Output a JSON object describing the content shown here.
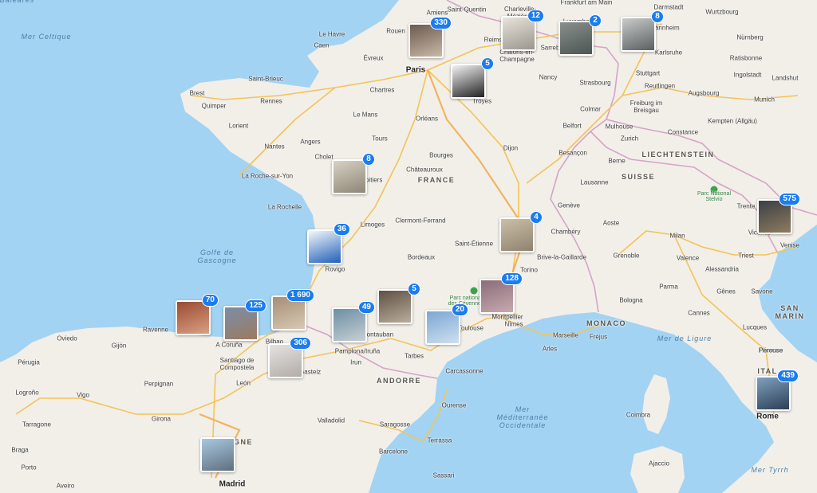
{
  "colors": {
    "water": "#a3d3f3",
    "land": "#f2efe9",
    "border": "#d6a3c8",
    "road": "#f4c356",
    "highway": "#f4a844",
    "badge": "#1a7cf0"
  },
  "labels": [
    {
      "text": "Mer Celtique",
      "cls": "sea"
    },
    {
      "text": "Golfe de\nGascogne",
      "cls": "sea"
    },
    {
      "text": "Mer de Ligure",
      "cls": "sea"
    },
    {
      "text": "Mer\nMéditerranée\nOccidentale",
      "cls": "sea"
    },
    {
      "text": "Mer Tyrrh",
      "cls": "sea"
    },
    {
      "text": "FRANCE",
      "cls": "country"
    },
    {
      "text": "SUISSE",
      "cls": "country"
    },
    {
      "text": "ITAL",
      "cls": "country"
    },
    {
      "text": "GNE",
      "cls": "country"
    },
    {
      "text": "ANDORRE",
      "cls": "country"
    },
    {
      "text": "MONACO",
      "cls": "country"
    },
    {
      "text": "LIECHTENSTEIN",
      "cls": "country"
    },
    {
      "text": "SAN\nMARIN",
      "cls": "country"
    },
    {
      "text": "Paris",
      "cls": "capital"
    },
    {
      "text": "Madrid",
      "cls": "capital"
    },
    {
      "text": "Rome",
      "cls": "capital"
    },
    {
      "text": "Amiens"
    },
    {
      "text": "Saint-Quentin"
    },
    {
      "text": "Frankfurt am Main"
    },
    {
      "text": "Darmstadt"
    },
    {
      "text": "Wurtzbourg"
    },
    {
      "text": "Le Havre"
    },
    {
      "text": "Rouen"
    },
    {
      "text": "Caen"
    },
    {
      "text": "Évreux"
    },
    {
      "text": "Charleville-\nMézières"
    },
    {
      "text": "Reims"
    },
    {
      "text": "Châlons-en-\nChampagne"
    },
    {
      "text": "Luxembourg"
    },
    {
      "text": "Sarrebruck"
    },
    {
      "text": "Mannheim"
    },
    {
      "text": "Karlsruhe"
    },
    {
      "text": "Nürnberg"
    },
    {
      "text": "Ratisbonne"
    },
    {
      "text": "Ingolstadt"
    },
    {
      "text": "Landshut"
    },
    {
      "text": "Brest"
    },
    {
      "text": "Saint-Brieuc"
    },
    {
      "text": "Quimper"
    },
    {
      "text": "Rennes"
    },
    {
      "text": "Lorient"
    },
    {
      "text": "Chartres"
    },
    {
      "text": "Nancy"
    },
    {
      "text": "Strasbourg"
    },
    {
      "text": "Stuttgart"
    },
    {
      "text": "Reutlingen"
    },
    {
      "text": "Augsbourg"
    },
    {
      "text": "Munich"
    },
    {
      "text": "Le Mans"
    },
    {
      "text": "Orléans"
    },
    {
      "text": "Troyes"
    },
    {
      "text": "Colmar"
    },
    {
      "text": "Freiburg im\nBreisgau"
    },
    {
      "text": "Mulhouse"
    },
    {
      "text": "Constance"
    },
    {
      "text": "Kempten (Allgäu)"
    },
    {
      "text": "Angers"
    },
    {
      "text": "Tours"
    },
    {
      "text": "Nantes"
    },
    {
      "text": "Cholet"
    },
    {
      "text": "Dijon"
    },
    {
      "text": "Belfort"
    },
    {
      "text": "Besançon"
    },
    {
      "text": "Zurich"
    },
    {
      "text": "Bourges"
    },
    {
      "text": "Châteauroux"
    },
    {
      "text": "La Roche-sur-Yon"
    },
    {
      "text": "Poitiers"
    },
    {
      "text": "Berne"
    },
    {
      "text": "Lausanne"
    },
    {
      "text": "La Rochelle"
    },
    {
      "text": "Genève"
    },
    {
      "text": "Limoges"
    },
    {
      "text": "Clermont-Ferrand"
    },
    {
      "text": "Lyon"
    },
    {
      "text": "Chambéry"
    },
    {
      "text": "Saint-Étienne"
    },
    {
      "text": "Aoste"
    },
    {
      "text": "Milan"
    },
    {
      "text": "Trente"
    },
    {
      "text": "Vicence"
    },
    {
      "text": "Venise"
    },
    {
      "text": "Triest"
    },
    {
      "text": "Rovigo"
    },
    {
      "text": "Bordeaux"
    },
    {
      "text": "Brive-la-Gaillarde"
    },
    {
      "text": "Grenoble"
    },
    {
      "text": "Torino"
    },
    {
      "text": "Valence"
    },
    {
      "text": "Alessandria"
    },
    {
      "text": "Parma"
    },
    {
      "text": "Gênes"
    },
    {
      "text": "Bologna"
    },
    {
      "text": "Savone"
    },
    {
      "text": "Ravenne"
    },
    {
      "text": "Gijón"
    },
    {
      "text": "Oviedo"
    },
    {
      "text": "A Coruña"
    },
    {
      "text": "Bilbao"
    },
    {
      "text": "Irun"
    },
    {
      "text": "Montauban"
    },
    {
      "text": "Toulouse"
    },
    {
      "text": "Montpellier"
    },
    {
      "text": "Nîmes"
    },
    {
      "text": "Arles"
    },
    {
      "text": "Marseille"
    },
    {
      "text": "Fréjus"
    },
    {
      "text": "Cannes"
    },
    {
      "text": "Lucques"
    },
    {
      "text": "Florence"
    },
    {
      "text": "Pérouse"
    },
    {
      "text": "Pérugia"
    },
    {
      "text": "Santiago de\nCompostela"
    },
    {
      "text": "Vitoria-Gasteiz"
    },
    {
      "text": "Pamplona/Iruña"
    },
    {
      "text": "Tarbes"
    },
    {
      "text": "Carcassonne"
    },
    {
      "text": "Perpignan"
    },
    {
      "text": "León"
    },
    {
      "text": "Logroño"
    },
    {
      "text": "Vigo"
    },
    {
      "text": "Ourense"
    },
    {
      "text": "Girona"
    },
    {
      "text": "Valladolid"
    },
    {
      "text": "Saragosse"
    },
    {
      "text": "Terrassa"
    },
    {
      "text": "Barcelone"
    },
    {
      "text": "Tarragone"
    },
    {
      "text": "Braga"
    },
    {
      "text": "Porto"
    },
    {
      "text": "Aveiro"
    },
    {
      "text": "Coimbra"
    },
    {
      "text": "Ajaccio"
    },
    {
      "text": "Sassari"
    },
    {
      "text": "Mer des Baléares",
      "cls": "sea"
    }
  ],
  "parks": [
    {
      "text": "Parc National\nStelvio"
    },
    {
      "text": "Parc national\ndes Cévennes"
    }
  ],
  "clusters": [
    {
      "count": "330",
      "place": "Paris"
    },
    {
      "count": "12",
      "place": "Reims"
    },
    {
      "count": "2",
      "place": "Luxembourg"
    },
    {
      "count": "8",
      "place": "Mannheim"
    },
    {
      "count": "5",
      "place": "Troyes"
    },
    {
      "count": "8",
      "place": "Poitiers"
    },
    {
      "count": "575",
      "place": "Trente"
    },
    {
      "count": "4",
      "place": "Lyon"
    },
    {
      "count": "36",
      "place": "Bordeaux"
    },
    {
      "count": "128",
      "place": "Nîmes"
    },
    {
      "count": "70",
      "place": "Gijón"
    },
    {
      "count": "125",
      "place": "Bilbao"
    },
    {
      "count": "1 690",
      "place": "Irun"
    },
    {
      "count": "49",
      "place": "Tarbes"
    },
    {
      "count": "5",
      "place": "Toulouse"
    },
    {
      "count": "20",
      "place": "Montpellier"
    },
    {
      "count": "306",
      "place": "Pamplona"
    },
    {
      "count": "439",
      "place": "Rome"
    },
    {
      "count": "",
      "place": "Madrid"
    }
  ]
}
